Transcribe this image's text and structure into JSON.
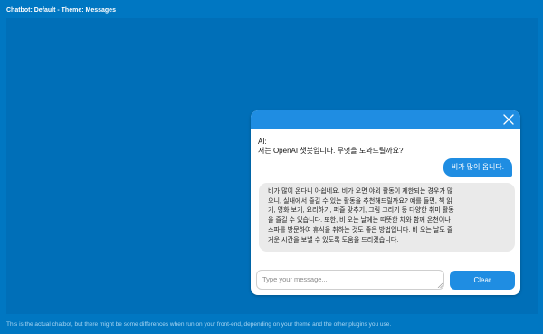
{
  "page": {
    "title": "Chatbot: Default - Theme: Messages",
    "footer_note": "This is the actual chatbot, but there might be some differences when run on your front-end, depending on your theme and the other plugins you use."
  },
  "colors": {
    "background": "#0077c2",
    "panel": "#006fb8",
    "accent": "#1f8de2",
    "bot_bubble": "#eaeaea",
    "chat_window": "#ffffff"
  },
  "chat": {
    "header": {
      "close_icon": "close-icon"
    },
    "greeting": {
      "speaker": "AI:",
      "text": "저는 OpenAI 챗봇입니다. 무엇을 도와드릴까요?"
    },
    "user_message": "비가 많이 옵니다.",
    "bot_reply_lines": [
      "비가 많이 온다니 아쉽네요. 비가 오면 야외 활동이 제한되는 경우가 많",
      "으니, 실내에서 즐길 수 있는 활동을 추천해드릴까요? 예를 들면, 책 읽",
      "기, 영화 보기, 요리하기, 퍼즐 맞추기, 그림 그리기 등 다양한 취미 활동",
      "을 즐길 수 있습니다. 또한, 비 오는 날에는 따뜻한 차와 함께 온천이나",
      "스파를 방문하여 휴식을 취하는 것도 좋은 방법입니다. 비 오는 날도 즐",
      "거운 시간을 보낼 수 있도록 도움을 드리겠습니다."
    ],
    "input": {
      "placeholder": "Type your message...",
      "value": ""
    },
    "clear_label": "Clear"
  }
}
